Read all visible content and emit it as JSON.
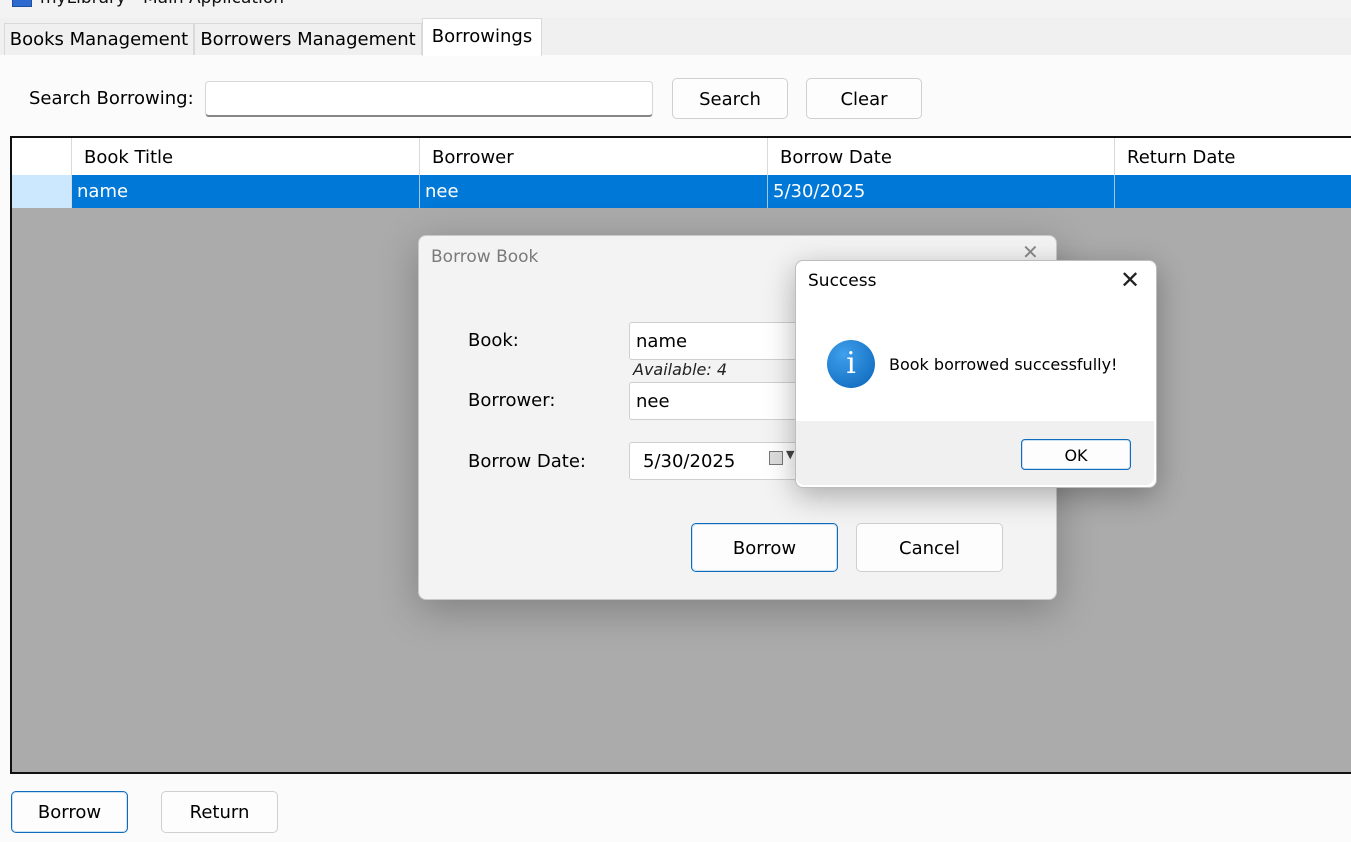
{
  "window": {
    "title": "myLibrary - Main Application"
  },
  "tabs": [
    "Books Management",
    "Borrowers Management",
    "Borrowings"
  ],
  "search": {
    "label": "Search Borrowing:",
    "value": "",
    "search_label": "Search",
    "clear_label": "Clear"
  },
  "table": {
    "columns": [
      "Book Title",
      "Borrower",
      "Borrow Date",
      "Return Date"
    ],
    "rows": [
      {
        "book_title": "name",
        "borrower": "nee",
        "borrow_date": "5/30/2025",
        "return_date": ""
      }
    ]
  },
  "footer": {
    "borrow_label": "Borrow",
    "return_label": "Return"
  },
  "borrow_dialog": {
    "title": "Borrow Book",
    "book_label": "Book:",
    "book_value": "name",
    "available": "Available: 4",
    "borrower_label": "Borrower:",
    "borrower_value": "nee",
    "date_label": "Borrow Date:",
    "date_value": "5/30/2025",
    "borrow_label": "Borrow",
    "cancel_label": "Cancel"
  },
  "success_dialog": {
    "title": "Success",
    "message": "Book borrowed successfully!",
    "ok_label": "OK",
    "icon": "info-icon"
  },
  "colors": {
    "selection": "#0078d7",
    "accent": "#0f6cbd",
    "grid_bg": "#ababab"
  }
}
